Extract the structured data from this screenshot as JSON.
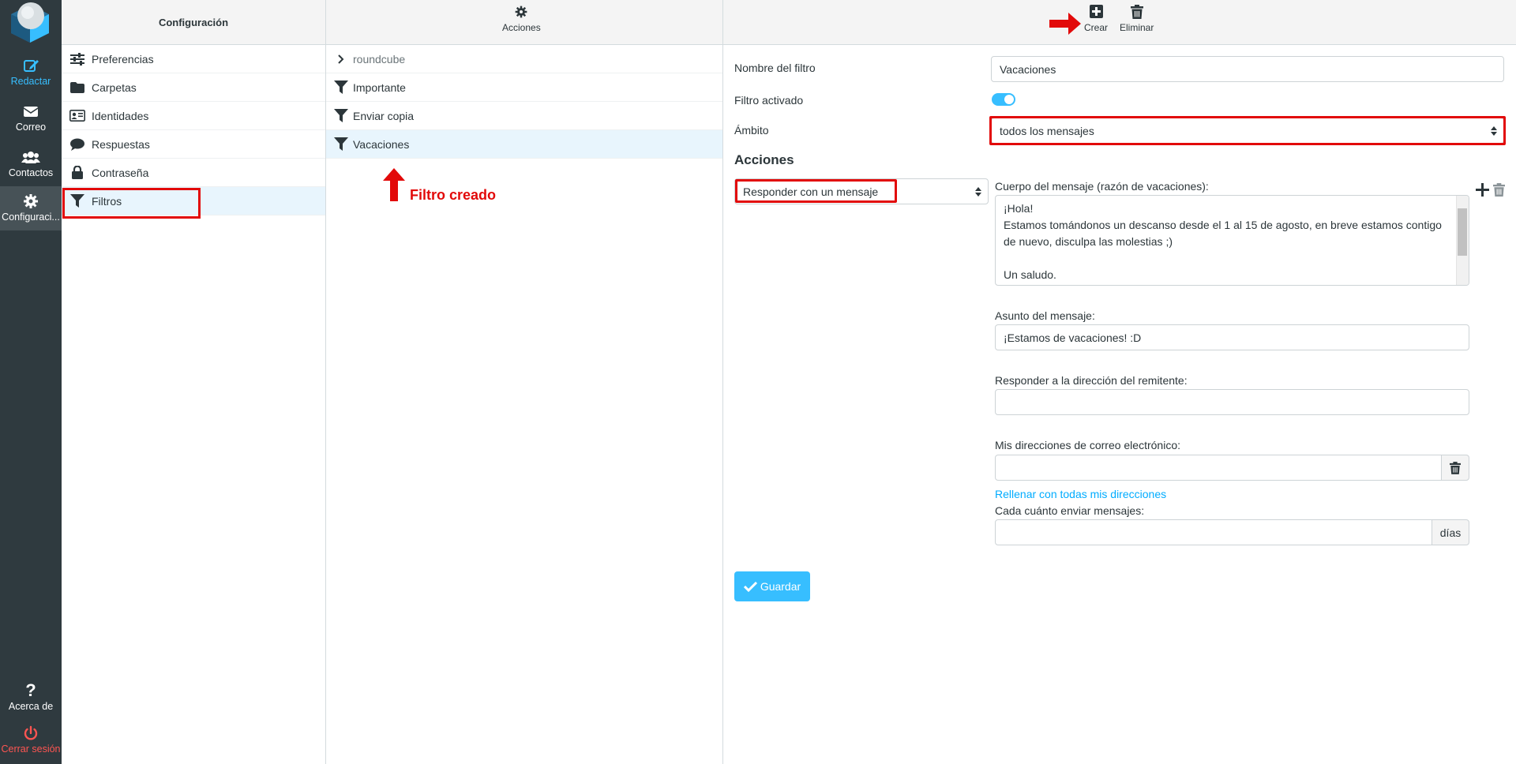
{
  "nav": {
    "compose": "Redactar",
    "mail": "Correo",
    "contacts": "Contactos",
    "settings": "Configuraci...",
    "about": "Acerca de",
    "logout": "Cerrar sesión"
  },
  "settings": {
    "title": "Configuración",
    "items": [
      {
        "label": "Preferencias",
        "icon": "sliders-icon"
      },
      {
        "label": "Carpetas",
        "icon": "folder-icon"
      },
      {
        "label": "Identidades",
        "icon": "id-card-icon"
      },
      {
        "label": "Respuestas",
        "icon": "comment-icon"
      },
      {
        "label": "Contraseña",
        "icon": "lock-icon"
      },
      {
        "label": "Filtros",
        "icon": "filter-icon"
      }
    ]
  },
  "filters": {
    "actions_label": "Acciones",
    "set_name": "roundcube",
    "items": [
      "Importante",
      "Enviar copia",
      "Vacaciones"
    ],
    "created_note": "Filtro creado"
  },
  "toolbar": {
    "create": "Crear",
    "delete": "Eliminar"
  },
  "form": {
    "name_label": "Nombre del filtro",
    "name_value": "Vacaciones",
    "enabled_label": "Filtro activado",
    "enabled": true,
    "scope_label": "Ámbito",
    "scope_value": "todos los mensajes",
    "actions_heading": "Acciones",
    "action_value": "Responder con un mensaje",
    "body_label": "Cuerpo del mensaje (razón de vacaciones):",
    "body_lines": [
      "¡Hola!",
      "Estamos tomándonos un descanso desde el 1 al 15 de agosto, en breve estamos contigo",
      "de nuevo, disculpa las molestias ;)",
      "",
      "Un saludo."
    ],
    "subject_label": "Asunto del mensaje:",
    "subject_value": "¡Estamos de vacaciones! :D",
    "reply_from_label": "Responder a la dirección del remitente:",
    "reply_from_value": "",
    "my_addresses_label": "Mis direcciones de correo electrónico:",
    "my_addresses_value": "",
    "fill_all_link": "Rellenar con todas mis direcciones",
    "interval_label": "Cada cuánto enviar mensajes:",
    "interval_value": "",
    "interval_unit": "días",
    "save": "Guardar"
  },
  "colors": {
    "accent": "#37beff",
    "highlight_red": "#e20a0a",
    "nav_bg": "#2f3a3f"
  }
}
